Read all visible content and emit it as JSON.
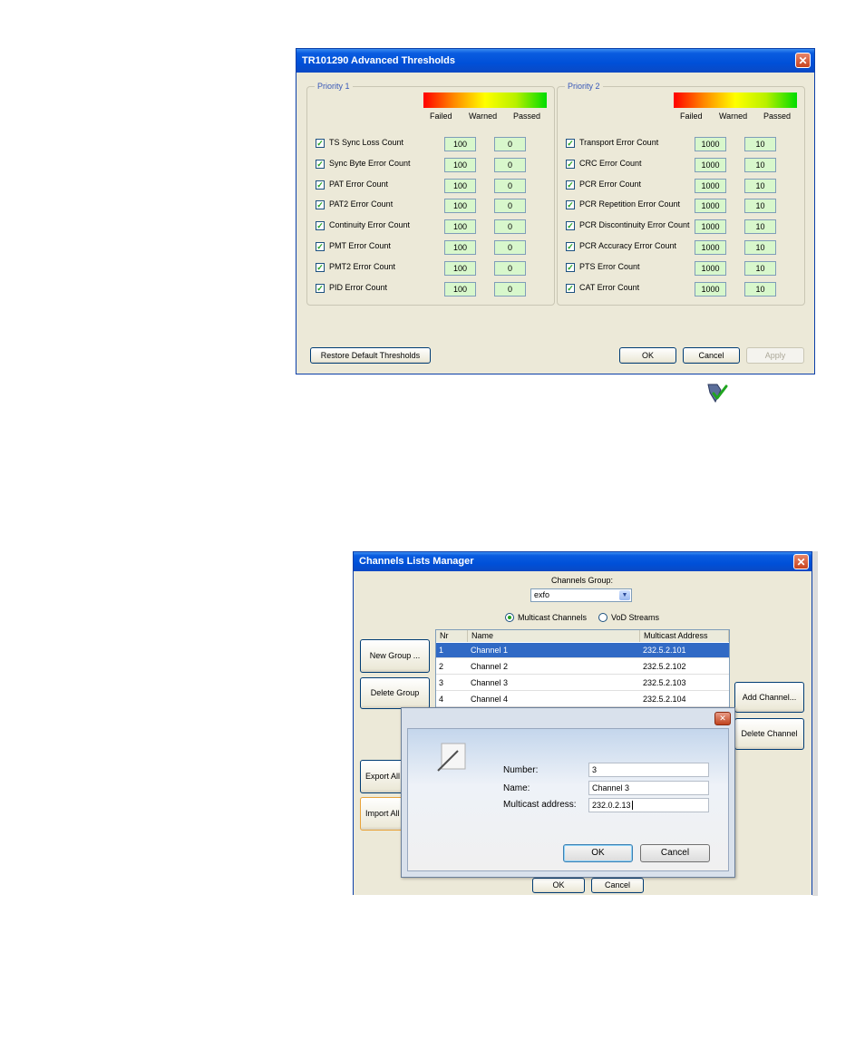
{
  "thresholds_dialog": {
    "title": "TR101290 Advanced Thresholds",
    "close_glyph": "✕",
    "check_glyph": "✓",
    "legend_labels": [
      "Failed",
      "Warned",
      "Passed"
    ],
    "priority1": {
      "label": "Priority 1",
      "rows": [
        {
          "label": "TS Sync Loss Count",
          "failed": "100",
          "passed": "0",
          "checked": true
        },
        {
          "label": "Sync Byte Error Count",
          "failed": "100",
          "passed": "0",
          "checked": true
        },
        {
          "label": "PAT Error Count",
          "failed": "100",
          "passed": "0",
          "checked": true
        },
        {
          "label": "PAT2 Error Count",
          "failed": "100",
          "passed": "0",
          "checked": true
        },
        {
          "label": "Continuity Error Count",
          "failed": "100",
          "passed": "0",
          "checked": true
        },
        {
          "label": "PMT Error Count",
          "failed": "100",
          "passed": "0",
          "checked": true
        },
        {
          "label": "PMT2 Error Count",
          "failed": "100",
          "passed": "0",
          "checked": true
        },
        {
          "label": "PID Error Count",
          "failed": "100",
          "passed": "0",
          "checked": true
        }
      ]
    },
    "priority2": {
      "label": "Priority 2",
      "rows": [
        {
          "label": "Transport Error Count",
          "failed": "1000",
          "passed": "10",
          "checked": true
        },
        {
          "label": "CRC Error Count",
          "failed": "1000",
          "passed": "10",
          "checked": true
        },
        {
          "label": "PCR Error Count",
          "failed": "1000",
          "passed": "10",
          "checked": true
        },
        {
          "label": "PCR Repetition Error Count",
          "failed": "1000",
          "passed": "10",
          "checked": true
        },
        {
          "label": "PCR Discontinuity Error Count",
          "failed": "1000",
          "passed": "10",
          "checked": true
        },
        {
          "label": "PCR Accuracy Error Count",
          "failed": "1000",
          "passed": "10",
          "checked": true
        },
        {
          "label": "PTS Error Count",
          "failed": "1000",
          "passed": "10",
          "checked": true
        },
        {
          "label": "CAT Error Count",
          "failed": "1000",
          "passed": "10",
          "checked": true
        }
      ]
    },
    "buttons": {
      "restore": "Restore Default Thresholds",
      "ok": "OK",
      "cancel": "Cancel",
      "apply": "Apply"
    }
  },
  "cursor_icon": "pointer-with-checkmark-icon",
  "channels_dialog": {
    "title": "Channels Lists Manager",
    "close_glyph": "✕",
    "group_label": "Channels Group:",
    "group_value": "exfo",
    "dropdown_glyph": "▼",
    "radio_multicast": "Multicast Channels",
    "radio_vod": "VoD Streams",
    "columns": [
      "Nr",
      "Name",
      "Multicast Address"
    ],
    "rows": [
      {
        "nr": "1",
        "name": "Channel 1",
        "address": "232.5.2.101"
      },
      {
        "nr": "2",
        "name": "Channel 2",
        "address": "232.5.2.102"
      },
      {
        "nr": "3",
        "name": "Channel 3",
        "address": "232.5.2.103"
      },
      {
        "nr": "4",
        "name": "Channel 4",
        "address": "232.5.2.104"
      }
    ],
    "buttons": {
      "new_group": "New Group ...",
      "delete_group": "Delete Group",
      "export_all": "Export All C",
      "import_all": "Import All C",
      "add_channel": "Add Channel...",
      "delete_channel": "Delete Channel",
      "ok": "OK",
      "cancel": "Cancel"
    }
  },
  "edit_channel_dialog": {
    "close_glyph": "✕",
    "fields": {
      "number_label": "Number:",
      "number_value": "3",
      "name_label": "Name:",
      "name_value": "Channel 3",
      "address_label": "Multicast address:",
      "address_value": "232.0.2.13"
    },
    "buttons": {
      "ok": "OK",
      "cancel": "Cancel"
    }
  },
  "colors": {
    "xp_title_blue": "#0050d8",
    "dialog_bg": "#ece9d8",
    "threshold_field_bg": "#d8f7cc",
    "selection_blue": "#316ac5"
  }
}
